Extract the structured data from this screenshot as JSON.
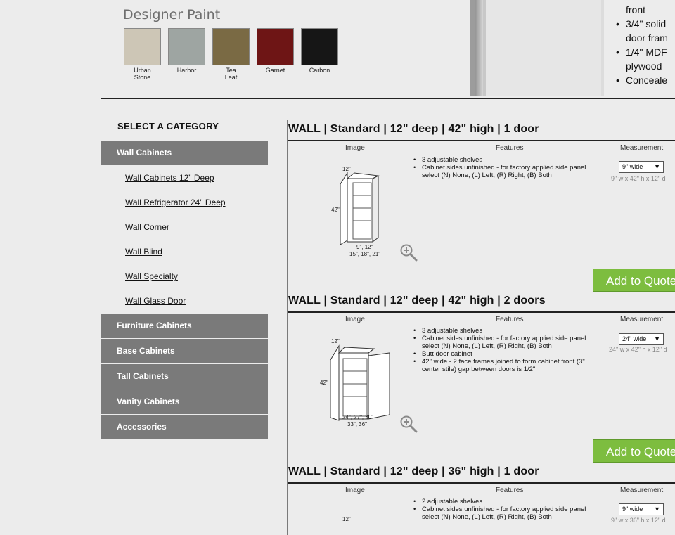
{
  "paint": {
    "heading": "Designer Paint",
    "swatches": [
      {
        "name_l1": "Urban",
        "name_l2": "Stone",
        "color": "#cdc6b6"
      },
      {
        "name_l1": "Harbor",
        "name_l2": "",
        "color": "#9ea5a2"
      },
      {
        "name_l1": "Tea",
        "name_l2": "Leaf",
        "color": "#7a6a44"
      },
      {
        "name_l1": "Garnet",
        "name_l2": "",
        "color": "#6e1515"
      },
      {
        "name_l1": "Carbon",
        "name_l2": "",
        "color": "#161616"
      }
    ]
  },
  "description": {
    "line_front": "front",
    "bullet1_l1": "3/4\" solid",
    "bullet1_l2": "door fram",
    "bullet2_l1": "1/4\" MDF",
    "bullet2_l2": "plywood",
    "bullet3_l1": "Conceale"
  },
  "sidebar": {
    "title": "SELECT A CATEGORY",
    "active": "Wall Cabinets",
    "sublinks": [
      "Wall Cabinets 12\" Deep",
      "Wall Refrigerator 24\" Deep",
      "Wall Corner",
      "Wall Blind",
      "Wall Specialty",
      "Wall Glass Door"
    ],
    "categories": [
      "Furniture Cabinets",
      "Base Cabinets",
      "Tall Cabinets",
      "Vanity Cabinets",
      "Accessories"
    ]
  },
  "columns": {
    "image": "Image",
    "features": "Features",
    "measurement": "Measurement"
  },
  "products": [
    {
      "title": "WALL | Standard | 12\" deep | 42\" high | 1 door",
      "features": [
        "3 adjustable shelves",
        "Cabinet sides unfinished - for factory applied side panel select (N) None, (L) Left, (R) Right, (B) Both"
      ],
      "width_select": "9\" wide",
      "dims": "9\" w x 42\" h x 12\" d",
      "img_depth": "12\"",
      "img_height": "42\"",
      "img_widths_l1": "9\", 12\"",
      "img_widths_l2": "15\", 18\", 21\"",
      "button": "Add to Quote"
    },
    {
      "title": "WALL | Standard | 12\" deep | 42\" high | 2 doors",
      "features": [
        "3 adjustable shelves",
        "Cabinet sides unfinished - for factory applied side panel select (N) None, (L) Left, (R) Right, (B) Both",
        "Butt door cabinet",
        "42\" wide - 2 face frames joined to form cabinet front (3\" center stile) gap between doors is 1/2\""
      ],
      "width_select": "24\" wide",
      "dims": "24\" w x 42\" h x 12\" d",
      "img_depth": "12\"",
      "img_height": "42\"",
      "img_widths_l1": "24\", 27\", 30\"",
      "img_widths_l2": "33\", 36\"",
      "button": "Add to Quote"
    },
    {
      "title": "WALL | Standard | 12\" deep | 36\" high | 1 door",
      "features": [
        "2 adjustable shelves",
        "Cabinet sides unfinished - for factory applied side panel select (N) None, (L) Left, (R) Right, (B) Both"
      ],
      "width_select": "9\" wide",
      "dims": "9\" w x 36\" h x 12\" d",
      "img_depth": "12\""
    }
  ],
  "icons": {
    "zoom": "zoom-in-icon",
    "dropdown": "triangle-down-icon"
  },
  "colors": {
    "sidebar": "#7a7a7a",
    "quote_button": "#7dbd3f",
    "background": "#ececec"
  }
}
